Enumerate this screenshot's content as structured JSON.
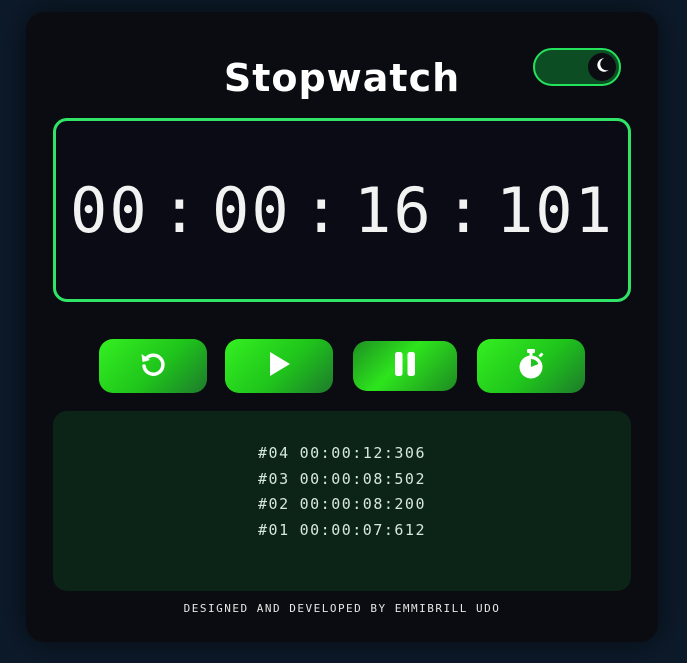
{
  "app": {
    "title": "Stopwatch",
    "theme_toggle": {
      "state": "dark",
      "icon": "moon-icon"
    }
  },
  "display": {
    "hours": "00",
    "minutes": "00",
    "seconds": "16",
    "milliseconds": "101",
    "separator": ":"
  },
  "controls": [
    {
      "name": "reset-button",
      "icon": "reset-icon"
    },
    {
      "name": "play-button",
      "icon": "play-icon"
    },
    {
      "name": "pause-button",
      "icon": "pause-icon"
    },
    {
      "name": "lap-button",
      "icon": "stopwatch-icon"
    }
  ],
  "laps": [
    {
      "num": "#04",
      "time": "00:00:12:306"
    },
    {
      "num": "#03",
      "time": "00:00:08:502"
    },
    {
      "num": "#02",
      "time": "00:00:08:200"
    },
    {
      "num": "#01",
      "time": "00:00:07:612"
    }
  ],
  "footer": {
    "credit": "DESIGNED AND DEVELOPED BY EMMIBRILL UDO"
  },
  "colors": {
    "accent": "#2fe467",
    "card": "#0b0c12",
    "page": "#0d1a2a",
    "laps_panel": "#0b2417"
  }
}
